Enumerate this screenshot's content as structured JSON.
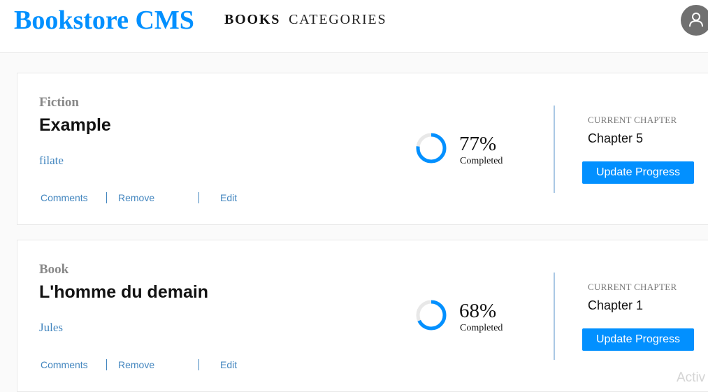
{
  "header": {
    "brand": "Bookstore CMS",
    "nav": [
      {
        "label": "BOOKS",
        "active": true
      },
      {
        "label": "CATEGORIES",
        "active": false
      }
    ],
    "avatar_icon": "user-icon"
  },
  "books": [
    {
      "genre": "Fiction",
      "title": "Example",
      "author": "filate",
      "actions": [
        "Comments",
        "Remove",
        "Edit"
      ],
      "progress_percent": 77,
      "progress_text": "77%",
      "completed_label": "Completed",
      "chapter_label": "CURRENT CHAPTER",
      "chapter": "Chapter 5",
      "button_label": "Update Progress"
    },
    {
      "genre": "Book",
      "title": "L'homme du demain",
      "author": "Jules",
      "actions": [
        "Comments",
        "Remove",
        "Edit"
      ],
      "progress_percent": 68,
      "progress_text": "68%",
      "completed_label": "Completed",
      "chapter_label": "CURRENT CHAPTER",
      "chapter": "Chapter 1",
      "button_label": "Update Progress"
    }
  ],
  "watermark": "Activ",
  "colors": {
    "accent": "#0290ff",
    "link": "#4386bf",
    "ring_track": "#e8e8e8"
  }
}
